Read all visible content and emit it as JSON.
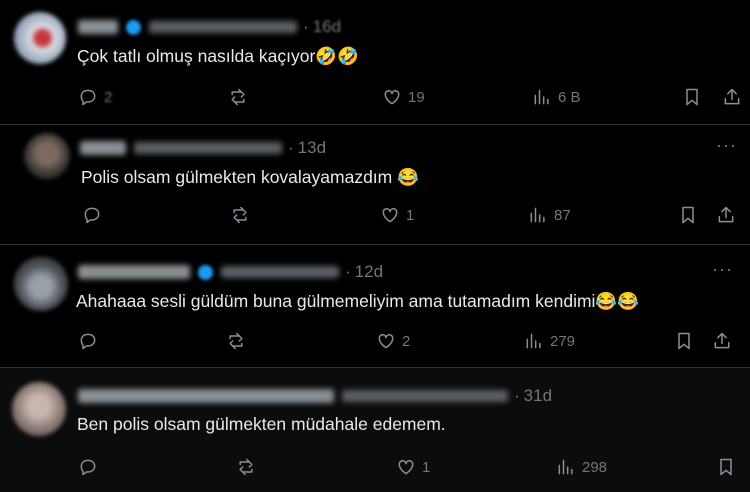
{
  "replies": [
    {
      "time": "16d",
      "text": "Çok tatlı olmuş nasılda kaçıyor",
      "emojis": "🤣🤣",
      "reply_count": "2",
      "likes": "19",
      "views": "6 B"
    },
    {
      "time": "13d",
      "text": "Polis olsam gülmekten kovalayamazdım",
      "emojis": "😂",
      "reply_count": "",
      "likes": "1",
      "views": "87"
    },
    {
      "time": "12d",
      "text": "Ahahaaa sesli güldüm buna gülmemeliyim ama tutamadım kendimi",
      "emojis": "😂😂",
      "reply_count": "",
      "likes": "2",
      "views": "279"
    },
    {
      "time": "31d",
      "text": "Ben polis olsam gülmekten müdahale edemem.",
      "emojis": "",
      "reply_count": "",
      "likes": "1",
      "views": "298"
    }
  ],
  "separator": "·",
  "more_glyph": "···",
  "colors": {
    "background": "#000000",
    "text": "#e7e9ea",
    "muted": "#71767b",
    "divider": "#2f3336",
    "verified": "#1d9bf0"
  },
  "icons": [
    "reply-icon",
    "retweet-icon",
    "like-icon",
    "views-icon",
    "bookmark-icon",
    "share-icon",
    "more-icon",
    "verified-icon"
  ]
}
